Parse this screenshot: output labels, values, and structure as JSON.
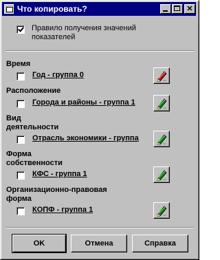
{
  "window": {
    "title": "Что копировать?"
  },
  "rule": {
    "label_line1": "Правило получения значений",
    "label_line2": "показателей",
    "checked": true
  },
  "sections": [
    {
      "title_lines": [
        "Время"
      ],
      "link": "Год - группа 0",
      "checked": false,
      "icon_color": "red"
    },
    {
      "title_lines": [
        "Расположение"
      ],
      "link": "Города и районы - группа 1",
      "checked": false,
      "icon_color": "green"
    },
    {
      "title_lines": [
        "Вид",
        "деятельности"
      ],
      "link": "Отрасль экономики - группа",
      "checked": false,
      "icon_color": "green"
    },
    {
      "title_lines": [
        "Форма",
        "собственности"
      ],
      "link": "КФС - группа 1",
      "checked": false,
      "icon_color": "green"
    },
    {
      "title_lines": [
        "Организационно-правовая",
        "форма"
      ],
      "link": "КОПФ - группа 1",
      "checked": false,
      "icon_color": "green"
    }
  ],
  "buttons": {
    "ok": "OK",
    "cancel": "Отмена",
    "help": "Справка"
  },
  "colors": {
    "titlebar": "#000080",
    "face": "#c0c0c0",
    "pencil_red": "#c00000",
    "pencil_green": "#008000"
  }
}
